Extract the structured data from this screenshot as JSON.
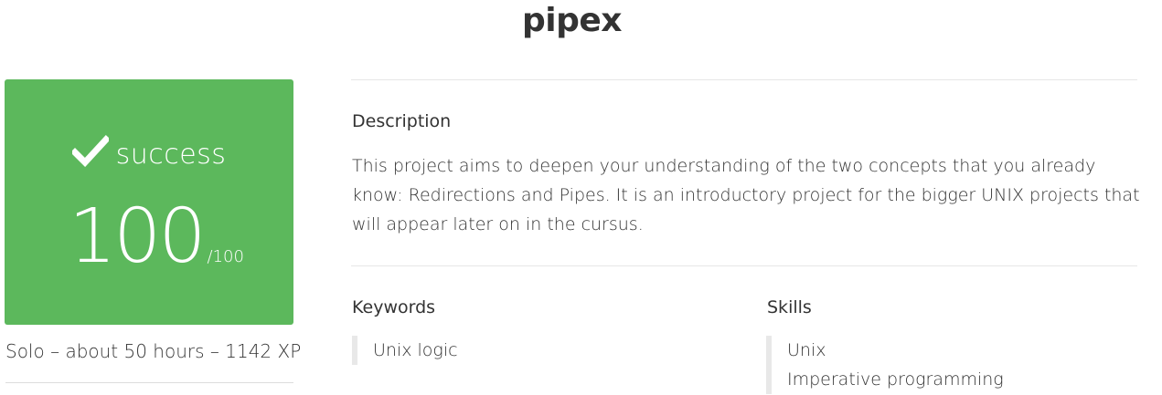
{
  "project": {
    "title": "pipex"
  },
  "score_card": {
    "status_icon": "checkmark-icon",
    "status": "success",
    "score": "100",
    "max": "/100",
    "color": "#5cb85c"
  },
  "meta": {
    "text": "Solo – about 50 hours – 1142 XP"
  },
  "description": {
    "heading": "Description",
    "text": "This project aims to deepen your understanding of the two concepts that you already know: Redirections and Pipes. It is an introductory project for the bigger UNIX projects that will appear later on in the cursus."
  },
  "keywords": {
    "heading": "Keywords",
    "items": [
      "Unix logic"
    ]
  },
  "skills": {
    "heading": "Skills",
    "items": [
      "Unix",
      "Imperative programming"
    ]
  }
}
